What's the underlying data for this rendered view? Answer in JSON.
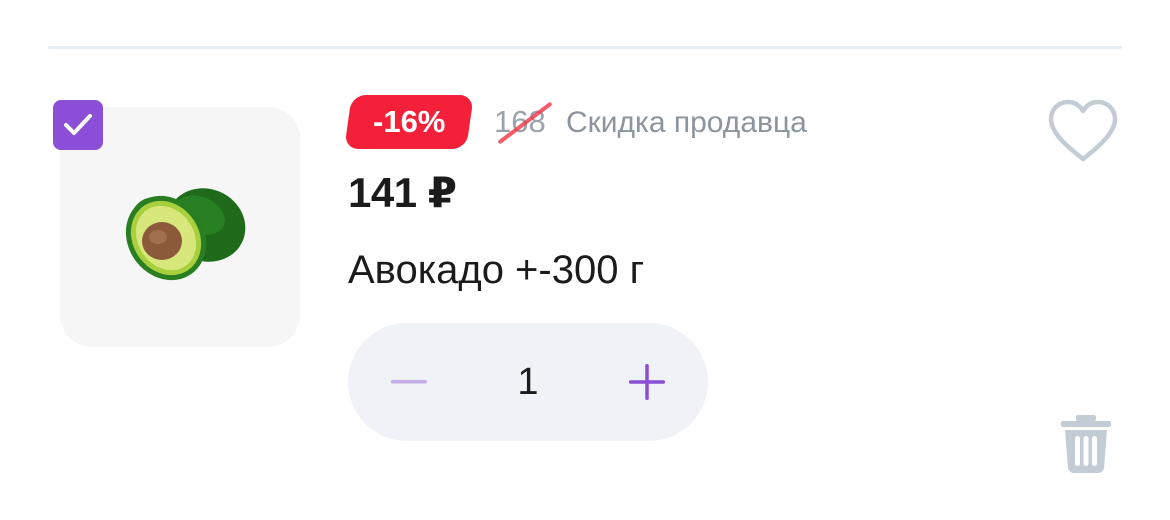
{
  "cart_item": {
    "selected": true,
    "image_alt": "avocado",
    "discount_badge": "-16%",
    "old_price": "168",
    "discount_note": "Скидка продавца",
    "price": "141 ₽",
    "title": "Авокадо +-300 г",
    "quantity": "1"
  },
  "icons": {
    "checkbox": "checkmark-icon",
    "favorite": "heart-outline-icon",
    "delete": "trash-icon",
    "decrement": "minus-icon",
    "increment": "plus-icon"
  },
  "colors": {
    "accent_purple": "#8a4fd6",
    "badge_red": "#f4203a",
    "muted_gray": "#9aa2ab",
    "icon_gray": "#c3ccd4",
    "stepper_bg": "#eff3f7"
  }
}
